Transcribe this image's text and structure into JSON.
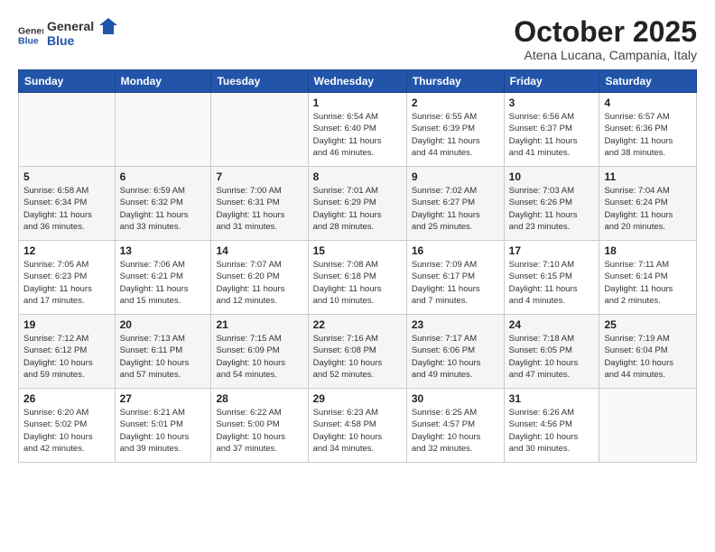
{
  "header": {
    "logo_general": "General",
    "logo_blue": "Blue",
    "month_title": "October 2025",
    "subtitle": "Atena Lucana, Campania, Italy"
  },
  "days_of_week": [
    "Sunday",
    "Monday",
    "Tuesday",
    "Wednesday",
    "Thursday",
    "Friday",
    "Saturday"
  ],
  "weeks": [
    [
      {
        "day": "",
        "info": ""
      },
      {
        "day": "",
        "info": ""
      },
      {
        "day": "",
        "info": ""
      },
      {
        "day": "1",
        "info": "Sunrise: 6:54 AM\nSunset: 6:40 PM\nDaylight: 11 hours\nand 46 minutes."
      },
      {
        "day": "2",
        "info": "Sunrise: 6:55 AM\nSunset: 6:39 PM\nDaylight: 11 hours\nand 44 minutes."
      },
      {
        "day": "3",
        "info": "Sunrise: 6:56 AM\nSunset: 6:37 PM\nDaylight: 11 hours\nand 41 minutes."
      },
      {
        "day": "4",
        "info": "Sunrise: 6:57 AM\nSunset: 6:36 PM\nDaylight: 11 hours\nand 38 minutes."
      }
    ],
    [
      {
        "day": "5",
        "info": "Sunrise: 6:58 AM\nSunset: 6:34 PM\nDaylight: 11 hours\nand 36 minutes."
      },
      {
        "day": "6",
        "info": "Sunrise: 6:59 AM\nSunset: 6:32 PM\nDaylight: 11 hours\nand 33 minutes."
      },
      {
        "day": "7",
        "info": "Sunrise: 7:00 AM\nSunset: 6:31 PM\nDaylight: 11 hours\nand 31 minutes."
      },
      {
        "day": "8",
        "info": "Sunrise: 7:01 AM\nSunset: 6:29 PM\nDaylight: 11 hours\nand 28 minutes."
      },
      {
        "day": "9",
        "info": "Sunrise: 7:02 AM\nSunset: 6:27 PM\nDaylight: 11 hours\nand 25 minutes."
      },
      {
        "day": "10",
        "info": "Sunrise: 7:03 AM\nSunset: 6:26 PM\nDaylight: 11 hours\nand 23 minutes."
      },
      {
        "day": "11",
        "info": "Sunrise: 7:04 AM\nSunset: 6:24 PM\nDaylight: 11 hours\nand 20 minutes."
      }
    ],
    [
      {
        "day": "12",
        "info": "Sunrise: 7:05 AM\nSunset: 6:23 PM\nDaylight: 11 hours\nand 17 minutes."
      },
      {
        "day": "13",
        "info": "Sunrise: 7:06 AM\nSunset: 6:21 PM\nDaylight: 11 hours\nand 15 minutes."
      },
      {
        "day": "14",
        "info": "Sunrise: 7:07 AM\nSunset: 6:20 PM\nDaylight: 11 hours\nand 12 minutes."
      },
      {
        "day": "15",
        "info": "Sunrise: 7:08 AM\nSunset: 6:18 PM\nDaylight: 11 hours\nand 10 minutes."
      },
      {
        "day": "16",
        "info": "Sunrise: 7:09 AM\nSunset: 6:17 PM\nDaylight: 11 hours\nand 7 minutes."
      },
      {
        "day": "17",
        "info": "Sunrise: 7:10 AM\nSunset: 6:15 PM\nDaylight: 11 hours\nand 4 minutes."
      },
      {
        "day": "18",
        "info": "Sunrise: 7:11 AM\nSunset: 6:14 PM\nDaylight: 11 hours\nand 2 minutes."
      }
    ],
    [
      {
        "day": "19",
        "info": "Sunrise: 7:12 AM\nSunset: 6:12 PM\nDaylight: 10 hours\nand 59 minutes."
      },
      {
        "day": "20",
        "info": "Sunrise: 7:13 AM\nSunset: 6:11 PM\nDaylight: 10 hours\nand 57 minutes."
      },
      {
        "day": "21",
        "info": "Sunrise: 7:15 AM\nSunset: 6:09 PM\nDaylight: 10 hours\nand 54 minutes."
      },
      {
        "day": "22",
        "info": "Sunrise: 7:16 AM\nSunset: 6:08 PM\nDaylight: 10 hours\nand 52 minutes."
      },
      {
        "day": "23",
        "info": "Sunrise: 7:17 AM\nSunset: 6:06 PM\nDaylight: 10 hours\nand 49 minutes."
      },
      {
        "day": "24",
        "info": "Sunrise: 7:18 AM\nSunset: 6:05 PM\nDaylight: 10 hours\nand 47 minutes."
      },
      {
        "day": "25",
        "info": "Sunrise: 7:19 AM\nSunset: 6:04 PM\nDaylight: 10 hours\nand 44 minutes."
      }
    ],
    [
      {
        "day": "26",
        "info": "Sunrise: 6:20 AM\nSunset: 5:02 PM\nDaylight: 10 hours\nand 42 minutes."
      },
      {
        "day": "27",
        "info": "Sunrise: 6:21 AM\nSunset: 5:01 PM\nDaylight: 10 hours\nand 39 minutes."
      },
      {
        "day": "28",
        "info": "Sunrise: 6:22 AM\nSunset: 5:00 PM\nDaylight: 10 hours\nand 37 minutes."
      },
      {
        "day": "29",
        "info": "Sunrise: 6:23 AM\nSunset: 4:58 PM\nDaylight: 10 hours\nand 34 minutes."
      },
      {
        "day": "30",
        "info": "Sunrise: 6:25 AM\nSunset: 4:57 PM\nDaylight: 10 hours\nand 32 minutes."
      },
      {
        "day": "31",
        "info": "Sunrise: 6:26 AM\nSunset: 4:56 PM\nDaylight: 10 hours\nand 30 minutes."
      },
      {
        "day": "",
        "info": ""
      }
    ]
  ]
}
